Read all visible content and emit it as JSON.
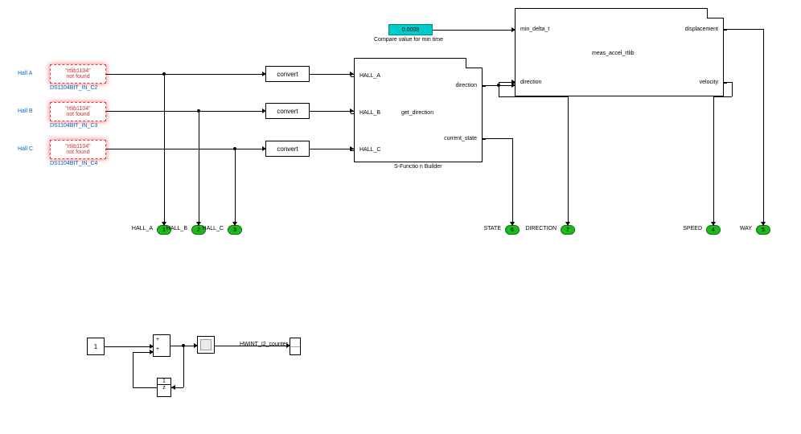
{
  "inputs": {
    "hallA": {
      "name": "Hall A",
      "error_line1": "\"rtlib1104\"",
      "error_line2": "not found",
      "block_label": "DS1104BIT_IN_C2"
    },
    "hallB": {
      "name": "Hall B",
      "error_line1": "\"rtlib1104\"",
      "error_line2": "not found",
      "block_label": "DS1104BIT_IN_C3"
    },
    "hallC": {
      "name": "Hall C",
      "error_line1": "\"rtlib1104\"",
      "error_line2": "not found",
      "block_label": "DS1104BIT_IN_C4"
    }
  },
  "converters": {
    "c1": "convert",
    "c2": "convert",
    "c3": "convert"
  },
  "sfunction": {
    "title": "S-Functio n Builder",
    "center_label": "get_direction",
    "ports_in": [
      {
        "name": "HALL_A"
      },
      {
        "name": "HALL_B"
      },
      {
        "name": "HALL_C"
      }
    ],
    "ports_out": [
      {
        "name": "direction"
      },
      {
        "name": "current_state"
      }
    ]
  },
  "constant": {
    "value": "0.0008",
    "label": "Compare value for min time"
  },
  "meas_block": {
    "title": "meas_accel_rtlib",
    "ports_in": [
      {
        "name": "min_delta_t"
      },
      {
        "name": "direction"
      }
    ],
    "ports_out": [
      {
        "name": "displacement"
      },
      {
        "name": "velocity"
      }
    ]
  },
  "outports": {
    "hallA": {
      "label": "HALL_A",
      "num": "1"
    },
    "hallB": {
      "label": "HALL_B",
      "num": "2"
    },
    "hallC": {
      "label": "HALL_C",
      "num": "3"
    },
    "state": {
      "label": "STATE",
      "num": "6"
    },
    "direction": {
      "label": "DIRECTION",
      "num": "7"
    },
    "speed": {
      "label": "SPEED",
      "num": "4"
    },
    "way": {
      "label": "WAY",
      "num": "5"
    }
  },
  "counter": {
    "const_value": "1",
    "display_label": "HWINT_I2_counter",
    "delay_label_top": "1",
    "delay_label_bot": "z"
  }
}
